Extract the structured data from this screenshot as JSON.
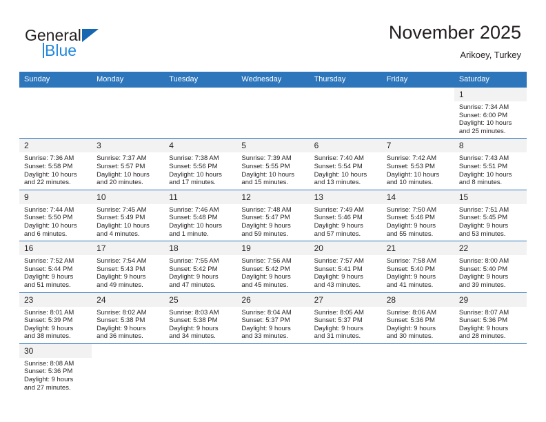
{
  "brand": {
    "name_top": "General",
    "name_bottom": "Blue",
    "accent_color": "#2288dd",
    "triangle_color": "#1667b2"
  },
  "header": {
    "title": "November 2025",
    "subtitle": "Arikoey, Turkey",
    "header_bg": "#2d76bb",
    "daynum_bg": "#f2f2f2"
  },
  "weekdays": [
    "Sunday",
    "Monday",
    "Tuesday",
    "Wednesday",
    "Thursday",
    "Friday",
    "Saturday"
  ],
  "labels": {
    "sunrise": "Sunrise:",
    "sunset": "Sunset:",
    "daylight": "Daylight:"
  },
  "weeks": [
    [
      {
        "day": "",
        "blank": true
      },
      {
        "day": "",
        "blank": true
      },
      {
        "day": "",
        "blank": true
      },
      {
        "day": "",
        "blank": true
      },
      {
        "day": "",
        "blank": true
      },
      {
        "day": "",
        "blank": true
      },
      {
        "day": "1",
        "sunrise": "Sunrise: 7:34 AM",
        "sunset": "Sunset: 6:00 PM",
        "daylight1": "Daylight: 10 hours",
        "daylight2": "and 25 minutes."
      }
    ],
    [
      {
        "day": "2",
        "sunrise": "Sunrise: 7:36 AM",
        "sunset": "Sunset: 5:58 PM",
        "daylight1": "Daylight: 10 hours",
        "daylight2": "and 22 minutes."
      },
      {
        "day": "3",
        "sunrise": "Sunrise: 7:37 AM",
        "sunset": "Sunset: 5:57 PM",
        "daylight1": "Daylight: 10 hours",
        "daylight2": "and 20 minutes."
      },
      {
        "day": "4",
        "sunrise": "Sunrise: 7:38 AM",
        "sunset": "Sunset: 5:56 PM",
        "daylight1": "Daylight: 10 hours",
        "daylight2": "and 17 minutes."
      },
      {
        "day": "5",
        "sunrise": "Sunrise: 7:39 AM",
        "sunset": "Sunset: 5:55 PM",
        "daylight1": "Daylight: 10 hours",
        "daylight2": "and 15 minutes."
      },
      {
        "day": "6",
        "sunrise": "Sunrise: 7:40 AM",
        "sunset": "Sunset: 5:54 PM",
        "daylight1": "Daylight: 10 hours",
        "daylight2": "and 13 minutes."
      },
      {
        "day": "7",
        "sunrise": "Sunrise: 7:42 AM",
        "sunset": "Sunset: 5:53 PM",
        "daylight1": "Daylight: 10 hours",
        "daylight2": "and 10 minutes."
      },
      {
        "day": "8",
        "sunrise": "Sunrise: 7:43 AM",
        "sunset": "Sunset: 5:51 PM",
        "daylight1": "Daylight: 10 hours",
        "daylight2": "and 8 minutes."
      }
    ],
    [
      {
        "day": "9",
        "sunrise": "Sunrise: 7:44 AM",
        "sunset": "Sunset: 5:50 PM",
        "daylight1": "Daylight: 10 hours",
        "daylight2": "and 6 minutes."
      },
      {
        "day": "10",
        "sunrise": "Sunrise: 7:45 AM",
        "sunset": "Sunset: 5:49 PM",
        "daylight1": "Daylight: 10 hours",
        "daylight2": "and 4 minutes."
      },
      {
        "day": "11",
        "sunrise": "Sunrise: 7:46 AM",
        "sunset": "Sunset: 5:48 PM",
        "daylight1": "Daylight: 10 hours",
        "daylight2": "and 1 minute."
      },
      {
        "day": "12",
        "sunrise": "Sunrise: 7:48 AM",
        "sunset": "Sunset: 5:47 PM",
        "daylight1": "Daylight: 9 hours",
        "daylight2": "and 59 minutes."
      },
      {
        "day": "13",
        "sunrise": "Sunrise: 7:49 AM",
        "sunset": "Sunset: 5:46 PM",
        "daylight1": "Daylight: 9 hours",
        "daylight2": "and 57 minutes."
      },
      {
        "day": "14",
        "sunrise": "Sunrise: 7:50 AM",
        "sunset": "Sunset: 5:46 PM",
        "daylight1": "Daylight: 9 hours",
        "daylight2": "and 55 minutes."
      },
      {
        "day": "15",
        "sunrise": "Sunrise: 7:51 AM",
        "sunset": "Sunset: 5:45 PM",
        "daylight1": "Daylight: 9 hours",
        "daylight2": "and 53 minutes."
      }
    ],
    [
      {
        "day": "16",
        "sunrise": "Sunrise: 7:52 AM",
        "sunset": "Sunset: 5:44 PM",
        "daylight1": "Daylight: 9 hours",
        "daylight2": "and 51 minutes."
      },
      {
        "day": "17",
        "sunrise": "Sunrise: 7:54 AM",
        "sunset": "Sunset: 5:43 PM",
        "daylight1": "Daylight: 9 hours",
        "daylight2": "and 49 minutes."
      },
      {
        "day": "18",
        "sunrise": "Sunrise: 7:55 AM",
        "sunset": "Sunset: 5:42 PM",
        "daylight1": "Daylight: 9 hours",
        "daylight2": "and 47 minutes."
      },
      {
        "day": "19",
        "sunrise": "Sunrise: 7:56 AM",
        "sunset": "Sunset: 5:42 PM",
        "daylight1": "Daylight: 9 hours",
        "daylight2": "and 45 minutes."
      },
      {
        "day": "20",
        "sunrise": "Sunrise: 7:57 AM",
        "sunset": "Sunset: 5:41 PM",
        "daylight1": "Daylight: 9 hours",
        "daylight2": "and 43 minutes."
      },
      {
        "day": "21",
        "sunrise": "Sunrise: 7:58 AM",
        "sunset": "Sunset: 5:40 PM",
        "daylight1": "Daylight: 9 hours",
        "daylight2": "and 41 minutes."
      },
      {
        "day": "22",
        "sunrise": "Sunrise: 8:00 AM",
        "sunset": "Sunset: 5:40 PM",
        "daylight1": "Daylight: 9 hours",
        "daylight2": "and 39 minutes."
      }
    ],
    [
      {
        "day": "23",
        "sunrise": "Sunrise: 8:01 AM",
        "sunset": "Sunset: 5:39 PM",
        "daylight1": "Daylight: 9 hours",
        "daylight2": "and 38 minutes."
      },
      {
        "day": "24",
        "sunrise": "Sunrise: 8:02 AM",
        "sunset": "Sunset: 5:38 PM",
        "daylight1": "Daylight: 9 hours",
        "daylight2": "and 36 minutes."
      },
      {
        "day": "25",
        "sunrise": "Sunrise: 8:03 AM",
        "sunset": "Sunset: 5:38 PM",
        "daylight1": "Daylight: 9 hours",
        "daylight2": "and 34 minutes."
      },
      {
        "day": "26",
        "sunrise": "Sunrise: 8:04 AM",
        "sunset": "Sunset: 5:37 PM",
        "daylight1": "Daylight: 9 hours",
        "daylight2": "and 33 minutes."
      },
      {
        "day": "27",
        "sunrise": "Sunrise: 8:05 AM",
        "sunset": "Sunset: 5:37 PM",
        "daylight1": "Daylight: 9 hours",
        "daylight2": "and 31 minutes."
      },
      {
        "day": "28",
        "sunrise": "Sunrise: 8:06 AM",
        "sunset": "Sunset: 5:36 PM",
        "daylight1": "Daylight: 9 hours",
        "daylight2": "and 30 minutes."
      },
      {
        "day": "29",
        "sunrise": "Sunrise: 8:07 AM",
        "sunset": "Sunset: 5:36 PM",
        "daylight1": "Daylight: 9 hours",
        "daylight2": "and 28 minutes."
      }
    ],
    [
      {
        "day": "30",
        "sunrise": "Sunrise: 8:08 AM",
        "sunset": "Sunset: 5:36 PM",
        "daylight1": "Daylight: 9 hours",
        "daylight2": "and 27 minutes."
      },
      {
        "day": "",
        "blank": true
      },
      {
        "day": "",
        "blank": true
      },
      {
        "day": "",
        "blank": true
      },
      {
        "day": "",
        "blank": true
      },
      {
        "day": "",
        "blank": true
      },
      {
        "day": "",
        "blank": true
      }
    ]
  ]
}
